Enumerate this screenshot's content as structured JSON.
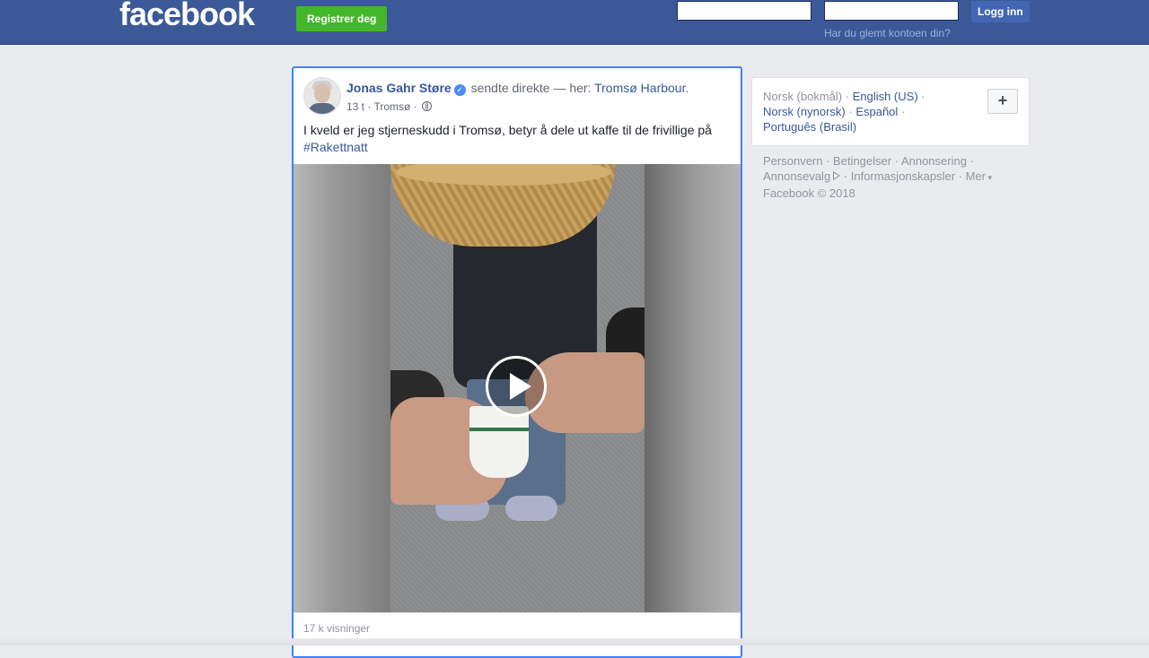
{
  "header": {
    "logo": "facebook",
    "register_label": "Registrer deg",
    "email_value": "",
    "password_value": "",
    "login_label": "Logg inn",
    "forgot_label": "Har du glemt kontoen din?"
  },
  "post": {
    "author": "Jonas Gahr Støre",
    "action": "sendte direkte — her:",
    "place": "Tromsø Harbour",
    "place_suffix": ".",
    "time": "13 t",
    "location": "Tromsø",
    "text": "I kveld er jeg stjerneskudd i Tromsø, betyr å dele ut kaffe til de frivillige på",
    "hashtag": "#Rakettnatt",
    "views": "17 k visninger"
  },
  "languages": {
    "current": "Norsk (bokmål)",
    "items": [
      "English (US)",
      "Norsk (nynorsk)",
      "Español",
      "Português (Brasil)"
    ],
    "add_label": "+"
  },
  "footer": {
    "links": [
      "Personvern",
      "Betingelser",
      "Annonsering",
      "Annonsevalg",
      "Informasjonskapsler",
      "Mer"
    ],
    "copyright": "Facebook © 2018"
  },
  "icons": {
    "verified": "verified-badge-icon",
    "audience": "globe-icon",
    "play": "play-icon",
    "adchoices": "adchoices-icon"
  },
  "colors": {
    "topbar": "#3b5998",
    "register": "#42b72a",
    "link": "#365899",
    "focus_border": "#4080ff"
  }
}
